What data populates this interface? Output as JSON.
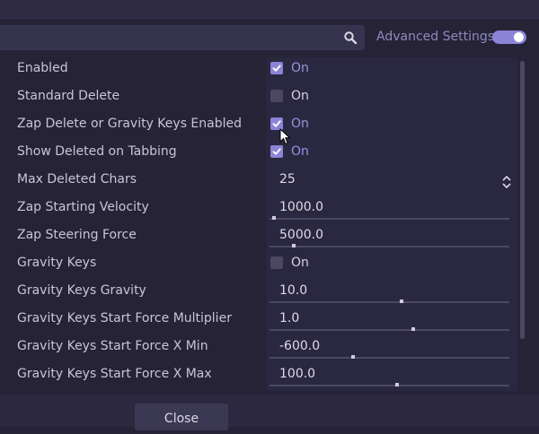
{
  "toolbar": {
    "search_icon": "search-icon",
    "advanced_label": "Advanced Settings",
    "advanced_enabled": true,
    "accent": "#8b84d6"
  },
  "settings": [
    {
      "label": "Enabled",
      "type": "checkbox",
      "checked": true,
      "value": "On"
    },
    {
      "label": "Standard Delete",
      "type": "checkbox",
      "checked": false,
      "value": "On"
    },
    {
      "label": "Zap Delete or Gravity Keys Enabled",
      "type": "checkbox",
      "checked": true,
      "value": "On"
    },
    {
      "label": "Show Deleted on Tabbing",
      "type": "checkbox",
      "checked": true,
      "value": "On"
    },
    {
      "label": "Max Deleted Chars",
      "type": "spin",
      "value": "25"
    },
    {
      "label": "Zap Starting Velocity",
      "type": "slider",
      "value": "1000.0",
      "fraction": 0.02
    },
    {
      "label": "Zap Steering Force",
      "type": "slider",
      "value": "5000.0",
      "fraction": 0.1
    },
    {
      "label": "Gravity Keys",
      "type": "checkbox",
      "checked": false,
      "value": "On"
    },
    {
      "label": "Gravity Keys Gravity",
      "type": "slider",
      "value": "10.0",
      "fraction": 0.55
    },
    {
      "label": "Gravity Keys Start Force Multiplier",
      "type": "slider",
      "value": "1.0",
      "fraction": 0.6
    },
    {
      "label": "Gravity Keys Start Force X Min",
      "type": "slider",
      "value": "-600.0",
      "fraction": 0.35
    },
    {
      "label": "Gravity Keys Start Force X Max",
      "type": "slider",
      "value": "100.0",
      "fraction": 0.53
    }
  ],
  "footer": {
    "close_label": "Close"
  }
}
